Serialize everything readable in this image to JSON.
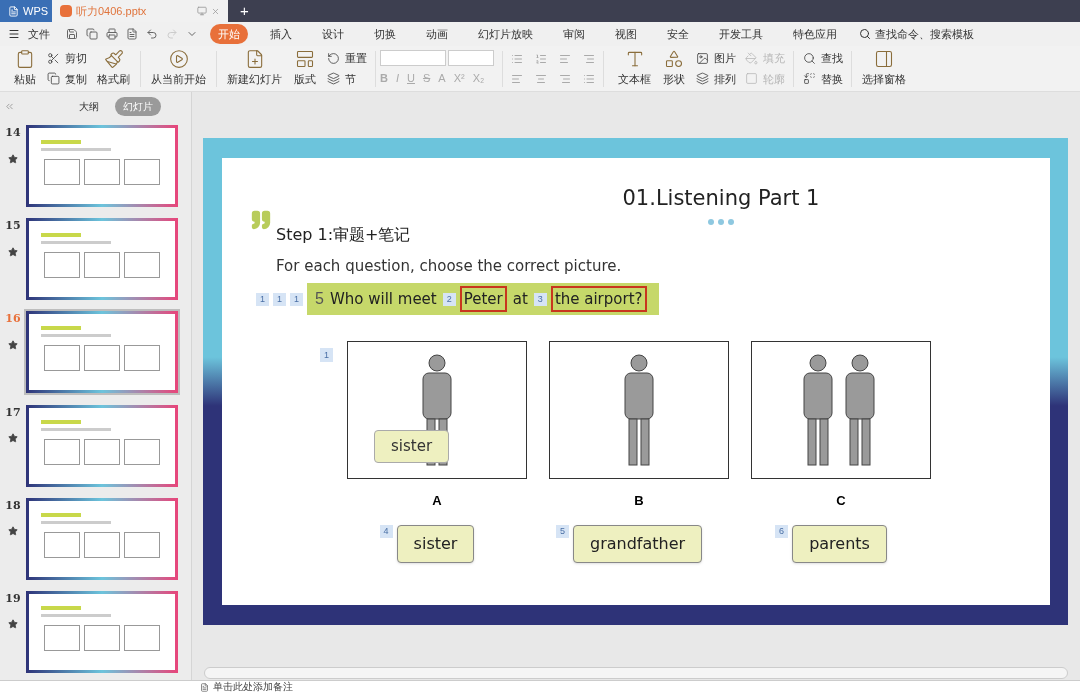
{
  "title_bar": {
    "app_tab": "WPS",
    "doc_tab": "听力0406.pptx",
    "new_tab": "+"
  },
  "menu": [
    {
      "label": "文件",
      "selected": false
    },
    {
      "label": "开始",
      "selected": true
    },
    {
      "label": "插入",
      "selected": false
    },
    {
      "label": "设计",
      "selected": false
    },
    {
      "label": "切换",
      "selected": false
    },
    {
      "label": "动画",
      "selected": false
    },
    {
      "label": "幻灯片放映",
      "selected": false
    },
    {
      "label": "审阅",
      "selected": false
    },
    {
      "label": "视图",
      "selected": false
    },
    {
      "label": "安全",
      "selected": false
    },
    {
      "label": "开发工具",
      "selected": false
    },
    {
      "label": "特色应用",
      "selected": false
    }
  ],
  "search": {
    "placeholder": "查找命令、搜索模板"
  },
  "toolbar_left": [
    {
      "label": "粘贴",
      "kind": "large"
    },
    {
      "kind": "stack",
      "items": [
        "剪切",
        "复制"
      ]
    },
    {
      "label": "格式刷",
      "kind": "large"
    },
    {
      "label": "从当前开始",
      "kind": "large"
    },
    {
      "label": "新建幻灯片",
      "kind": "large"
    },
    {
      "label": "版式",
      "kind": "large"
    },
    {
      "kind": "stack",
      "items": [
        "重置",
        "节"
      ]
    }
  ],
  "format_buttons": [
    "B",
    "I",
    "U",
    "S",
    "A",
    "X²",
    "X₂"
  ],
  "toolbar_right": [
    {
      "label": "文本框",
      "kind": "large",
      "disabled": false
    },
    {
      "label": "形状",
      "kind": "large",
      "disabled": false
    },
    {
      "kind": "stack",
      "items": [
        "图片",
        "排列"
      ],
      "disabled": false
    },
    {
      "kind": "stack",
      "items": [
        "填充",
        "轮廓"
      ],
      "disabled": true
    },
    {
      "kind": "stack",
      "items": [
        "查找",
        "替换"
      ],
      "disabled": false
    },
    {
      "label": "选择窗格",
      "kind": "large",
      "disabled": false
    }
  ],
  "panel_tabs": [
    {
      "label": "大纲",
      "selected": false
    },
    {
      "label": "幻灯片",
      "selected": true
    }
  ],
  "thumbnails": [
    {
      "number": "14",
      "selected": false
    },
    {
      "number": "15",
      "selected": false
    },
    {
      "number": "16",
      "selected": true
    },
    {
      "number": "17",
      "selected": false
    },
    {
      "number": "18",
      "selected": false
    },
    {
      "number": "19",
      "selected": false
    }
  ],
  "slide": {
    "title": "01.Listening Part 1",
    "step": "Step 1:审题+笔记",
    "instruction": "For each question, choose the correct picture.",
    "question": {
      "number": "5",
      "parts": [
        {
          "text": "Who will meet",
          "boxed": false
        },
        {
          "text": "Peter",
          "boxed": true
        },
        {
          "text": "at",
          "boxed": false
        },
        {
          "text": "the airport?",
          "boxed": true
        }
      ]
    },
    "question_tags": [
      "1",
      "1",
      "1",
      "2",
      "3"
    ],
    "pictures_tag": "1",
    "options": [
      {
        "letter": "A",
        "answer": "sister",
        "tag": "4"
      },
      {
        "letter": "B",
        "answer": "grandfather",
        "tag": "5"
      },
      {
        "letter": "C",
        "answer": "parents",
        "tag": "6"
      }
    ],
    "ghost_label": "sister"
  },
  "notes": {
    "placeholder": "单击此处添加备注"
  }
}
